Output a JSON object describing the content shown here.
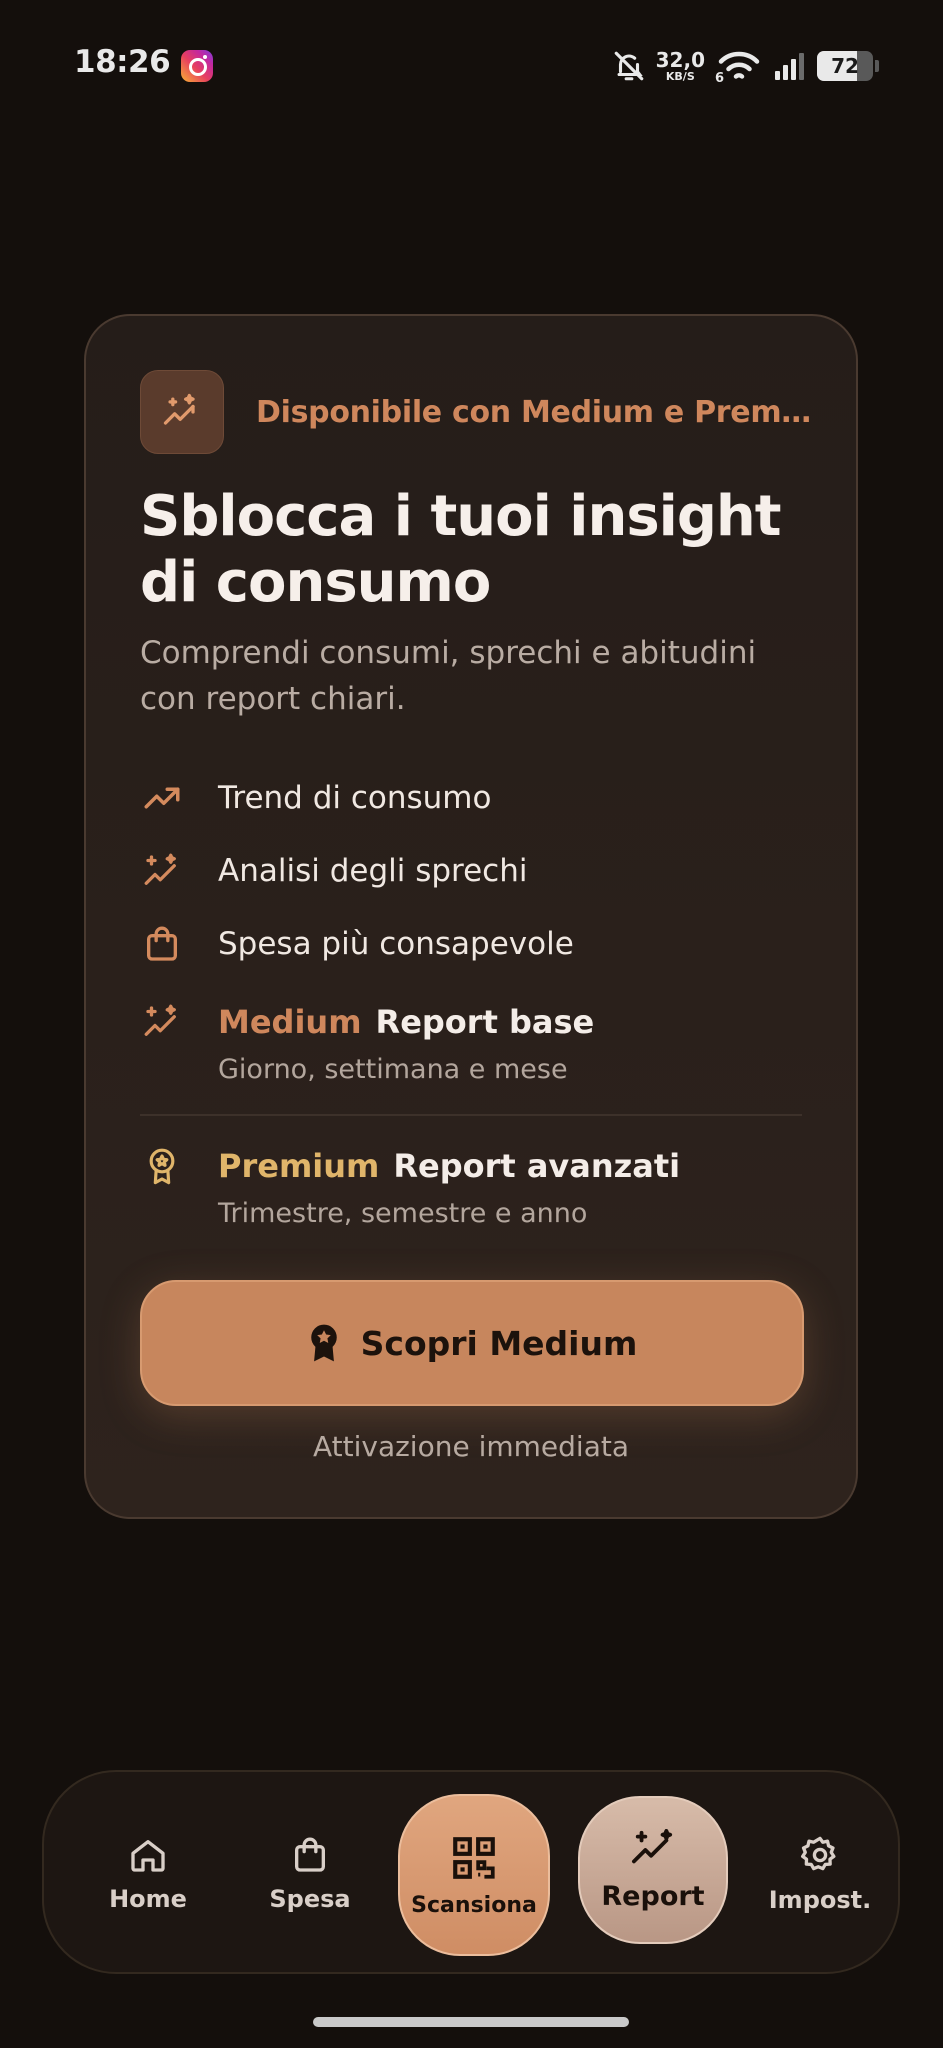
{
  "status_bar": {
    "time": "18:26",
    "speed_value": "32,0",
    "speed_unit": "KB/S",
    "wifi_label": "6",
    "battery": "72",
    "battery_level": 0.72
  },
  "card": {
    "badge": "Disponibile con Medium e Premi...",
    "title": "Sblocca i tuoi insight di consumo",
    "subtitle": "Comprendi consumi, sprechi e abitudini con report chiari.",
    "features": [
      {
        "icon": "trend-up-icon",
        "label": "Trend di consumo"
      },
      {
        "icon": "sparkle-chart-icon",
        "label": "Analisi degli sprechi"
      },
      {
        "icon": "shopping-bag-icon",
        "label": "Spesa più consapevole"
      }
    ],
    "medium": {
      "name": "Medium",
      "report": "Report base",
      "desc": "Giorno, settimana e mese"
    },
    "premium": {
      "name": "Premium",
      "report": "Report avanzati",
      "desc": "Trimestre, semestre e anno"
    },
    "cta_label": "Scopri Medium",
    "cta_note": "Attivazione immediata"
  },
  "nav": {
    "home": "Home",
    "spesa": "Spesa",
    "scan": "Scansiona",
    "report": "Report",
    "settings": "Impost."
  },
  "colors": {
    "accent": "#c7865d",
    "medium": "#cf875c",
    "premium": "#e0b56a",
    "background": "#140f0c"
  }
}
